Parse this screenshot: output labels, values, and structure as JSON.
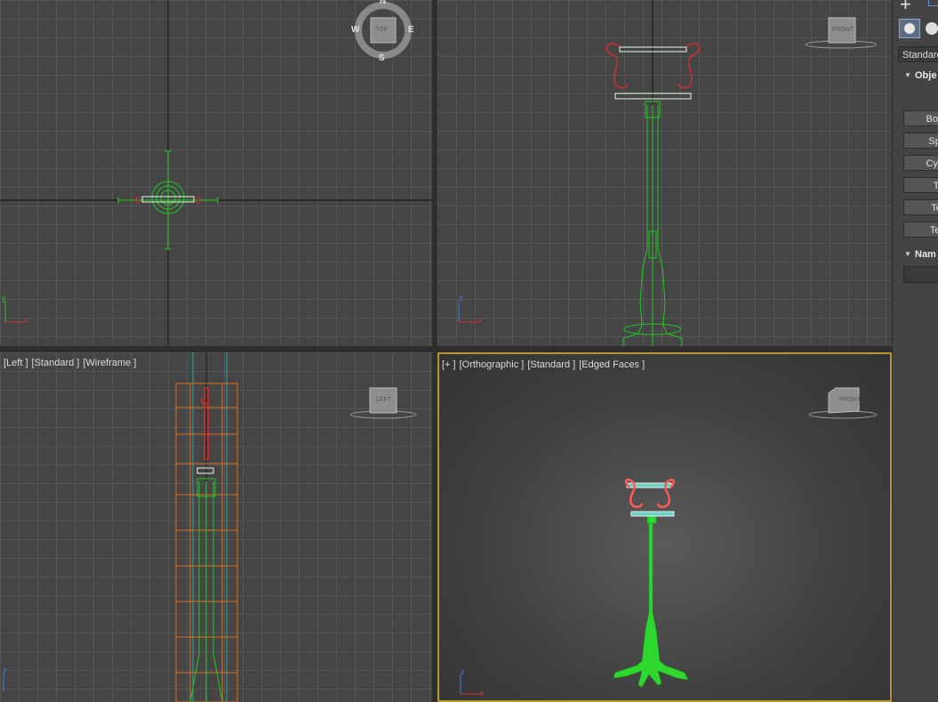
{
  "viewports": {
    "top": {
      "compass": {
        "n": "N",
        "s": "S",
        "e": "E",
        "w": "W",
        "cube": "TOP"
      },
      "axes": {
        "y": "y",
        "x": "x"
      }
    },
    "front": {
      "cube": "FRONT",
      "axes": {
        "z": "z",
        "x": "x"
      }
    },
    "left": {
      "label": {
        "a": "[Left ]",
        "b": "[Standard ]",
        "c": "[Wireframe ]"
      },
      "cube": "LEFT",
      "axes": {
        "z": "z"
      }
    },
    "perspective": {
      "label": {
        "a": "[+ ]",
        "b": "[Orthographic ]",
        "c": "[Standard ]",
        "d": "[Edged Faces ]"
      },
      "cube": "FRONT",
      "axes": {
        "z": "z",
        "x": "x"
      }
    }
  },
  "panel": {
    "dropdown": "Standard",
    "section_object": "Obje",
    "buttons": [
      "Bo",
      "Sph",
      "Cylin",
      "Tor",
      "Tea",
      "Text"
    ],
    "section_name": "Nam"
  },
  "colors": {
    "grid": "#454545",
    "wire_green": "#22c822",
    "wire_red": "#d22c2c",
    "active_border": "#b9942f"
  }
}
